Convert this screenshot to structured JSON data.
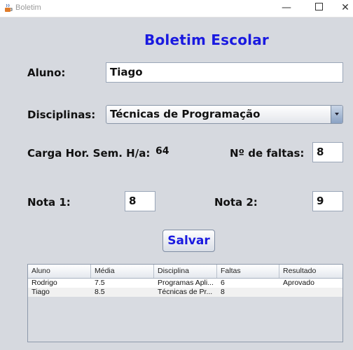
{
  "window": {
    "title": "Boletim",
    "minimize": "—",
    "close": "✕"
  },
  "form": {
    "heading": "Boletim Escolar",
    "aluno_label": "Aluno:",
    "aluno_value": "Tiago",
    "disciplinas_label": "Disciplinas:",
    "disciplina_value": "Técnicas de Programação",
    "carga_label": "Carga Hor. Sem. H/a:",
    "carga_value": "64",
    "faltas_label": "Nº de faltas:",
    "faltas_value": "8",
    "nota1_label": "Nota 1:",
    "nota1_value": "8",
    "nota2_label": "Nota 2:",
    "nota2_value": "9",
    "save_label": "Salvar"
  },
  "table": {
    "columns": [
      "Aluno",
      "Média",
      "Disciplina",
      "Faltas",
      "Resultado"
    ],
    "rows": [
      [
        "Rodrigo",
        "7.5",
        "Programas Apli...",
        "6",
        "Aprovado"
      ],
      [
        "Tiago",
        "8.5",
        "Técnicas de Pr...",
        "8",
        ""
      ]
    ]
  },
  "colors": {
    "accent": "#1a1ae0",
    "background": "#d6d9df"
  },
  "icons": {
    "app": "java-cup-icon",
    "combo": "chevron-down-icon"
  }
}
